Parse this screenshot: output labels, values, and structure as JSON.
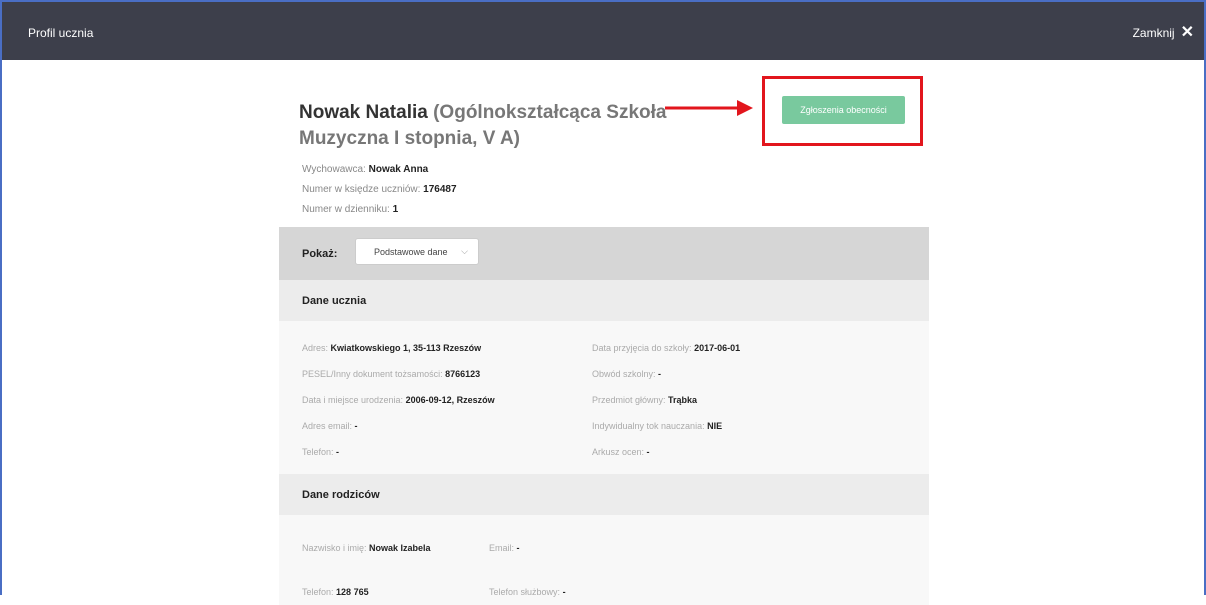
{
  "topbar": {
    "title": "Profil ucznia",
    "close_label": "Zamknij",
    "close_glyph": "✕"
  },
  "student": {
    "name": "Nowak Natalia",
    "school": " (Ogólnokształcąca Szkoła Muzyczna I stopnia, V A)"
  },
  "action_button": "Zgłoszenia obecności",
  "meta": {
    "teacher_label": "Wychowawca:",
    "teacher_value": "Nowak Anna",
    "register_label": "Numer w księdze uczniów:",
    "register_value": "176487",
    "journal_label": "Numer w dzienniku:",
    "journal_value": "1"
  },
  "show": {
    "label": "Pokaż:",
    "selected": "Podstawowe dane",
    "chevron": "⌵"
  },
  "sections": {
    "student_title": "Dane ucznia",
    "parents_title": "Dane rodziców"
  },
  "student_fields": {
    "address_label": "Adres:",
    "address_value": "Kwiatkowskiego 1, 35-113 Rzeszów",
    "pesel_label": "PESEL/Inny dokument tożsamości:",
    "pesel_value": "8766123",
    "birth_label": "Data i miejsce urodzenia:",
    "birth_value": "2006-09-12, Rzeszów",
    "email_label": "Adres email:",
    "email_value": "-",
    "phone_label": "Telefon:",
    "phone_value": "-",
    "admission_label": "Data przyjęcia do szkoły:",
    "admission_value": "2017-06-01",
    "district_label": "Obwód szkolny:",
    "district_value": "-",
    "subject_label": "Przedmiot główny:",
    "subject_value": "Trąbka",
    "individual_label": "Indywidualny tok nauczania:",
    "individual_value": "NIE",
    "sheet_label": "Arkusz ocen:",
    "sheet_value": "-"
  },
  "parent_fields": {
    "name_label": "Nazwisko i imię:",
    "name_value": "Nowak Izabela",
    "email_label": "Email:",
    "email_value": "-",
    "phone_label": "Telefon:",
    "phone_value": "128 765",
    "work_phone_label": "Telefon służbowy:",
    "work_phone_value": "-"
  },
  "colors": {
    "topbar": "#3d3f4b",
    "button": "#79c99e",
    "highlight": "#e2161d",
    "frame": "#4a6ec4"
  }
}
